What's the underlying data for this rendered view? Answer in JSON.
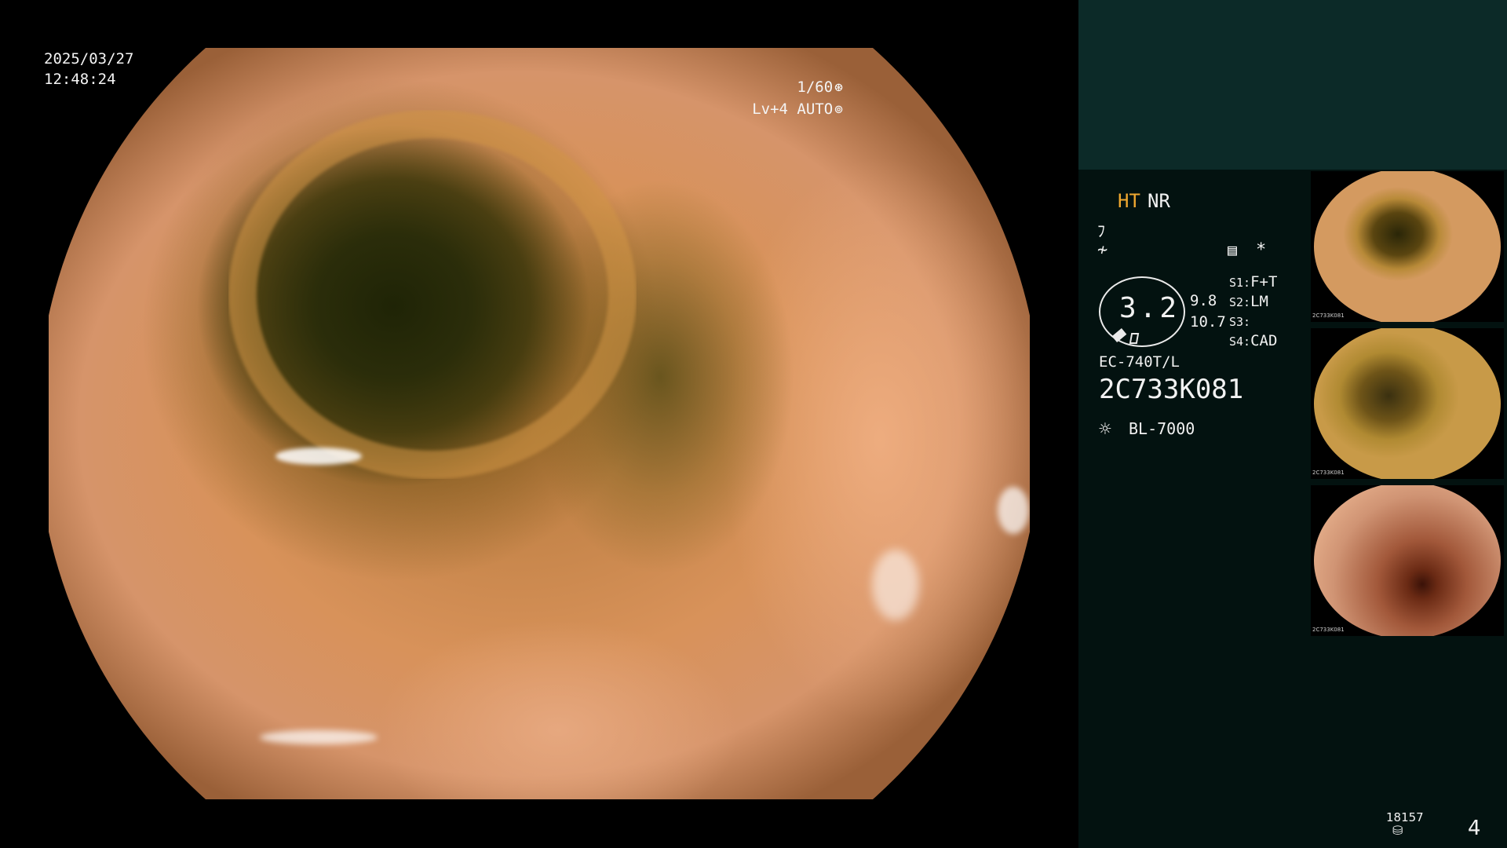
{
  "overlay": {
    "date": "2025/03/27",
    "time": "12:48:24",
    "shutter": "1/60",
    "level": "Lv+4 AUTO",
    "shutter_icon": "shutter-icon",
    "auto_icon": "auto-iris-icon"
  },
  "panel": {
    "ht": "HT",
    "nr": "NR",
    "dial_value": "3.2",
    "value_1": "9.8",
    "value_2": "10.7",
    "settings": [
      {
        "label": "S1:",
        "value": "F+T"
      },
      {
        "label": "S2:",
        "value": "LM"
      },
      {
        "label": "S3:",
        "value": ""
      },
      {
        "label": "S4:",
        "value": "CAD"
      }
    ],
    "model": "EC-740T/L",
    "serial": "2C733K081",
    "light_source": "BL-7000",
    "count": "18157",
    "page": "4"
  },
  "thumbnails": [
    {
      "id": "2C733K081"
    },
    {
      "id": "2C733K081"
    },
    {
      "id": "2C733K081"
    }
  ],
  "colors": {
    "panel_top": "#0c2a28",
    "panel": "#031210",
    "ht_accent": "#f0a830"
  }
}
